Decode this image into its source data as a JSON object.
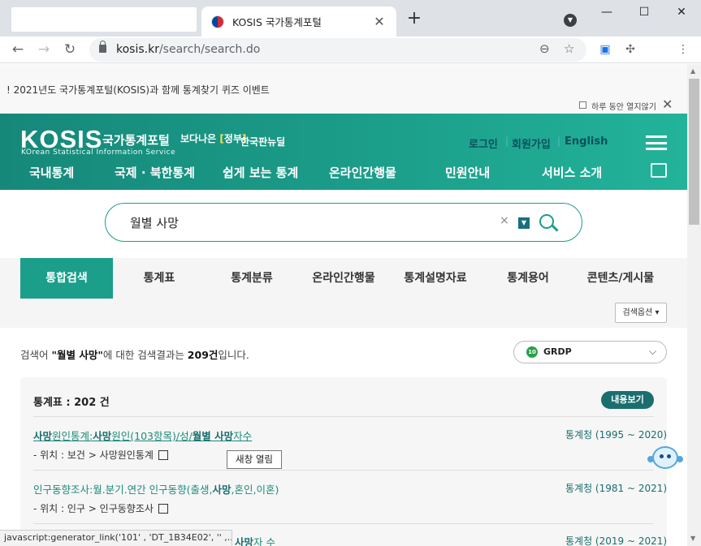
{
  "browser": {
    "tab_title": "KOSIS 국가통계포털",
    "tab_close": "✕",
    "new_tab": "+",
    "url_host": "kosis.kr",
    "url_path": "/search/search.do",
    "status_url": "javascript:generator_link('101' , 'DT_1B34E02', '' ,..."
  },
  "notice": {
    "text": "! 2021년도 국가통계포털(KOSIS)과 함께 통계찾기 퀴즈 이벤트",
    "checkbox_label": "하루 동안 열지않기",
    "close": "✕"
  },
  "header": {
    "logo": "KOSIS",
    "logo_kr": "국가통계포털",
    "logo_en": "KOrean Statistical Information Service",
    "badge1_a": "보다나은",
    "badge1_b": "정부",
    "badge2": "한국판뉴딜",
    "util": [
      "로그인",
      "회원가입",
      "English"
    ],
    "gnb": [
      "국내통계",
      "국제 · 북한통계",
      "쉽게 보는 통계",
      "온라인간행물",
      "민원안내",
      "서비스 소개"
    ]
  },
  "search": {
    "value": "월별 사망",
    "clear": "×",
    "dropdown": "▼"
  },
  "tabs": [
    "통합검색",
    "통계표",
    "통계분류",
    "온라인간행물",
    "통계설명자료",
    "통계용어",
    "콘텐츠/게시물"
  ],
  "options_button": "검색옵션 ▾",
  "summary": {
    "prefix": "검색어 ",
    "keyword": "\"월별 사망\"",
    "middle": "에 대한 검색결과는 ",
    "count": "209건",
    "suffix": "입니다."
  },
  "grdp": {
    "num": "10",
    "label": "GRDP",
    "arrow": "⌵"
  },
  "results": {
    "header": "통계표 : 202 건",
    "more_button": "내용보기",
    "items": [
      {
        "t1": "사망",
        "t2": "원인통계:",
        "t3": "사망",
        "t4": "원인(103항목)/성/",
        "t5": "월별 사망",
        "t6": "자수",
        "source": "통계청 (1995 ~ 2020)",
        "location": "- 위치 : 보건 > 사망원인통계"
      },
      {
        "t1": "인구동향조사:월.분기.연간 인구동향(출생,",
        "t2": "사망",
        "t3": ",혼인,이혼)",
        "source": "통계청 (1981 ~ 2021)",
        "location": "- 위치 : 인구 > 인구동향조사"
      },
      {
        "t1": "사망",
        "t2": "자 수",
        "source": "통계청 (2019 ~ 2021)"
      }
    ]
  },
  "tooltip": "새창 열림"
}
